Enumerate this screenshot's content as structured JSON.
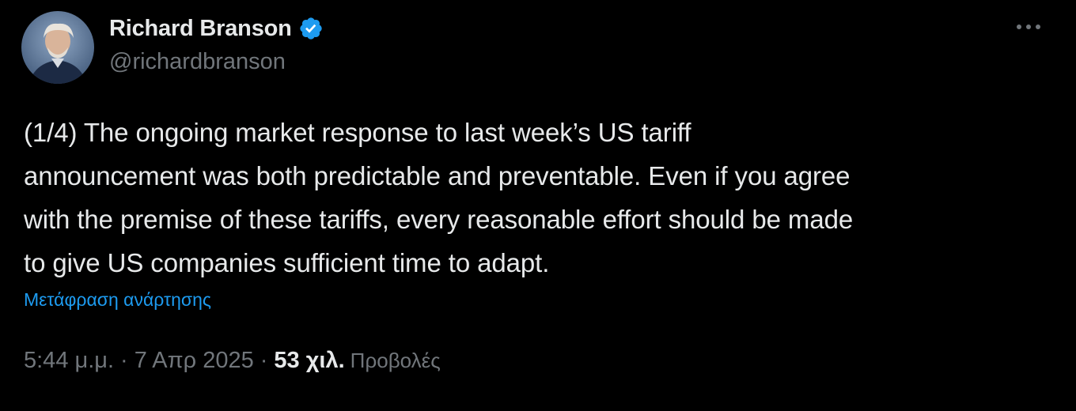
{
  "author": {
    "display_name": "Richard Branson",
    "handle": "@richardbranson",
    "verified": true
  },
  "tweet": {
    "text": "(1/4) The ongoing market response to last week’s US tariff\nannouncement was both predictable and preventable. Even if you agree\nwith the premise of these tariffs, every reasonable effort should be made\nto give US companies sufficient time to adapt.",
    "translate_link": "Μετάφραση ανάρτησης",
    "time": "5:44 μ.μ.",
    "date": "7 Απρ 2025",
    "separator": "·",
    "views_count": "53 χιλ.",
    "views_label": "Προβολές"
  },
  "icons": {
    "verified_badge": "verified-badge-icon",
    "more": "more-options-icon"
  },
  "colors": {
    "background": "#000000",
    "text_primary": "#e7e9ea",
    "text_secondary": "#71767b",
    "link": "#1d9bf0",
    "verified": "#1d9bf0"
  }
}
